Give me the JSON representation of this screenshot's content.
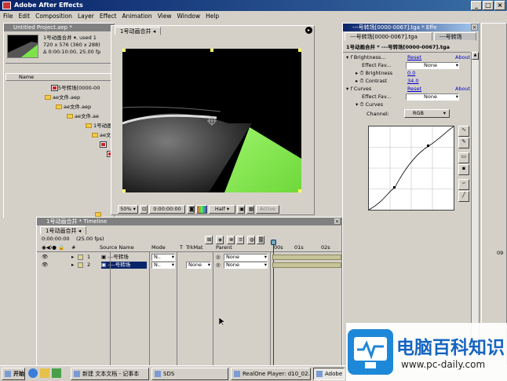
{
  "app": {
    "title": "Adobe After Effects"
  },
  "menu": [
    "File",
    "Edit",
    "Composition",
    "Layer",
    "Effect",
    "Animation",
    "View",
    "Window",
    "Help"
  ],
  "project": {
    "title": "Untitled Project.aep *",
    "info_line1": "1号动画合并 ▾, used 1",
    "info_line2": "720 x 576  (360 x 288)",
    "info_line3": "Δ 0:00:10:00, 25.00 fp",
    "col_name": "Name",
    "items": [
      {
        "label": "5号转场[0000-00",
        "type": "clip",
        "indent": 60
      },
      {
        "label": "ae文件.aep",
        "type": "folder",
        "indent": 52
      },
      {
        "label": "ae文件.aep",
        "type": "folder",
        "indent": 66
      },
      {
        "label": "ae文件.ae",
        "type": "folder",
        "indent": 80
      },
      {
        "label": "1号动画",
        "type": "folder",
        "indent": 104
      },
      {
        "label": "ae文",
        "type": "folder",
        "indent": 112
      }
    ]
  },
  "composition": {
    "tab": "1号动画合并",
    "zoom": "50%",
    "timecode": "0:00:00:00",
    "resolution": "Half",
    "active_camera": "Active"
  },
  "effects": {
    "title": "---号转场[0000-0067].tga * Effe",
    "tab_active": "---号转场[0000-0067].tga",
    "tab2": "---号转场",
    "breadcrumb": "1号动画合并 * ---号转场[0000-0067].tga",
    "brightness": {
      "name": "Brightness...",
      "reset": "Reset",
      "about": "About...",
      "fav_label": "Effect Fav...",
      "fav_value": "None",
      "b_label": "Brightness",
      "b_value": "0.0",
      "c_label": "Contrast",
      "c_value": "34.0"
    },
    "curves": {
      "name": "Curves",
      "reset": "Reset",
      "about": "About...",
      "fav_label": "Effect Fav...",
      "fav_value": "None",
      "sub_label": "Curves",
      "channel_label": "Channel:",
      "channel_value": "RGB"
    }
  },
  "timeline": {
    "title": "1号动画合并 * Timeline",
    "tab": "1号动画合并",
    "timecode": "0:00:00:00",
    "fps": "(25.00 fps)",
    "headers": {
      "num": "#",
      "source": "Source Name",
      "mode": "Mode",
      "t": "T",
      "trkmat": "TrkMat",
      "parent": "Parent"
    },
    "ruler": [
      "00s",
      "01s",
      "02s",
      "09"
    ],
    "layers": [
      {
        "num": "1",
        "name": "---号转场",
        "mode": "N..",
        "trkmat": "",
        "parent": "None"
      },
      {
        "num": "2",
        "name": "----号转场",
        "mode": "N..",
        "trkmat": "None",
        "parent": "None"
      }
    ]
  },
  "taskbar": {
    "start": "开始",
    "tasks": [
      "新建 文本文档 - 记事本",
      "SDS",
      "RealOne Player: d10_02...",
      "Adobe A"
    ]
  },
  "watermark": {
    "cn": "电脑百科知识",
    "url": "www.pc-daily.com"
  }
}
